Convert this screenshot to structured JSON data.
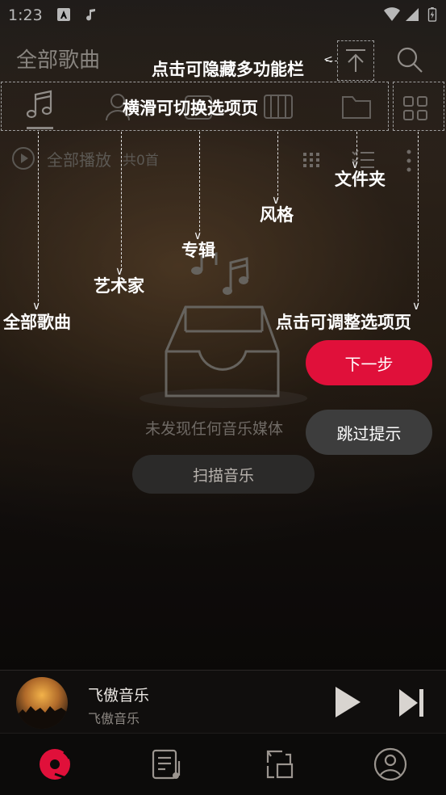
{
  "status_bar": {
    "time": "1:23"
  },
  "header": {
    "title": "全部歌曲"
  },
  "tabs": [
    {
      "name": "全部歌曲",
      "icon": "music-note-icon"
    },
    {
      "name": "艺术家",
      "icon": "person-icon"
    },
    {
      "name": "专辑",
      "icon": "album-icon"
    },
    {
      "name": "风格",
      "icon": "piano-icon"
    },
    {
      "name": "文件夹",
      "icon": "folder-icon"
    }
  ],
  "list_header": {
    "play_all": "全部播放",
    "count": "共0首"
  },
  "tips": {
    "hide_bar": "点击可隐藏多功能栏",
    "swipe_tabs": "横滑可切换选项页",
    "folder": "文件夹",
    "genre": "风格",
    "album": "专辑",
    "artist": "艺术家",
    "all_songs": "全部歌曲",
    "adjust_tabs": "点击可调整选项页"
  },
  "empty_state": {
    "message": "未发现任何音乐媒体",
    "scan_button": "扫描音乐"
  },
  "guide": {
    "next": "下一步",
    "skip": "跳过提示"
  },
  "player": {
    "title": "飞傲音乐",
    "artist": "飞傲音乐"
  },
  "colors": {
    "accent": "#e0103a",
    "skip_button": "#3d3d3d"
  }
}
